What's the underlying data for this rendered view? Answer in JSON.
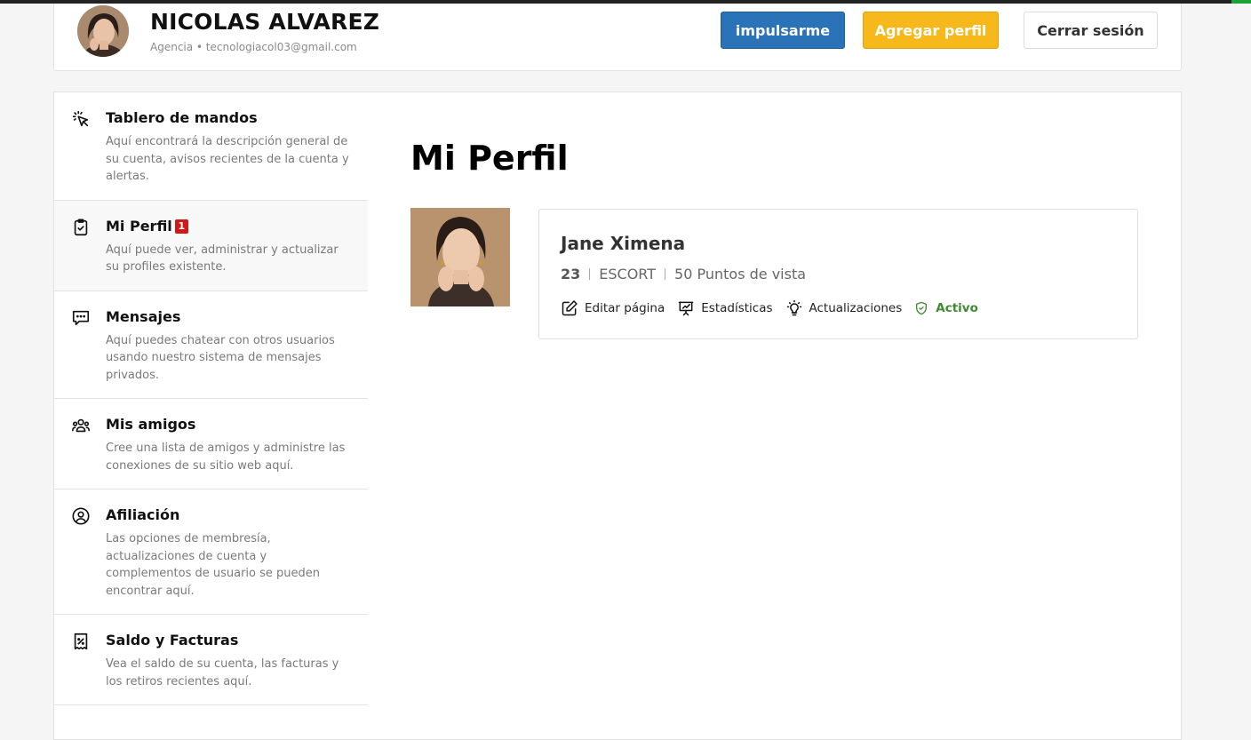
{
  "header": {
    "user_name": "NICOLAS ALVAREZ",
    "user_subtitle": "Agencia • tecnologiacol03@gmail.com",
    "boost_label": "impulsarme",
    "add_profile_label": "Agregar perfil",
    "logout_label": "Cerrar sesión"
  },
  "sidebar": {
    "items": [
      {
        "title": "Tablero de mandos",
        "desc": "Aquí encontrará la descripción general de su cuenta, avisos recientes de la cuenta y alertas.",
        "icon": "cursor-click-icon"
      },
      {
        "title": "Mi Perfil",
        "badge": "1",
        "desc": "Aquí puede ver, administrar y actualizar su profiles existente.",
        "icon": "clipboard-check-icon"
      },
      {
        "title": "Mensajes",
        "desc": "Aquí puedes chatear con otros usuarios usando nuestro sistema de mensajes privados.",
        "icon": "chat-icon"
      },
      {
        "title": "Mis amigos",
        "desc": "Cree una lista de amigos y administre las conexiones de su sitio web aquí.",
        "icon": "users-icon"
      },
      {
        "title": "Afiliación",
        "desc": "Las opciones de membresía, actualizaciones de cuenta y complementos de usuario se pueden encontrar aquí.",
        "icon": "user-circle-icon"
      },
      {
        "title": "Saldo y Facturas",
        "desc": "Vea el saldo de su cuenta, las facturas y los retiros recientes aquí.",
        "icon": "receipt-icon"
      }
    ]
  },
  "main": {
    "page_title": "Mi Perfil",
    "profile": {
      "name": "Jane Ximena",
      "age": "23",
      "category": "ESCORT",
      "views": "50 Puntos de vista",
      "actions": {
        "edit": "Editar página",
        "stats": "Estadísticas",
        "updates": "Actualizaciones"
      },
      "status": "Activo"
    }
  },
  "colors": {
    "boost": "#2a73b8",
    "add_profile": "#f6b81a",
    "badge": "#d01818",
    "active_status": "#3d8b2f"
  }
}
